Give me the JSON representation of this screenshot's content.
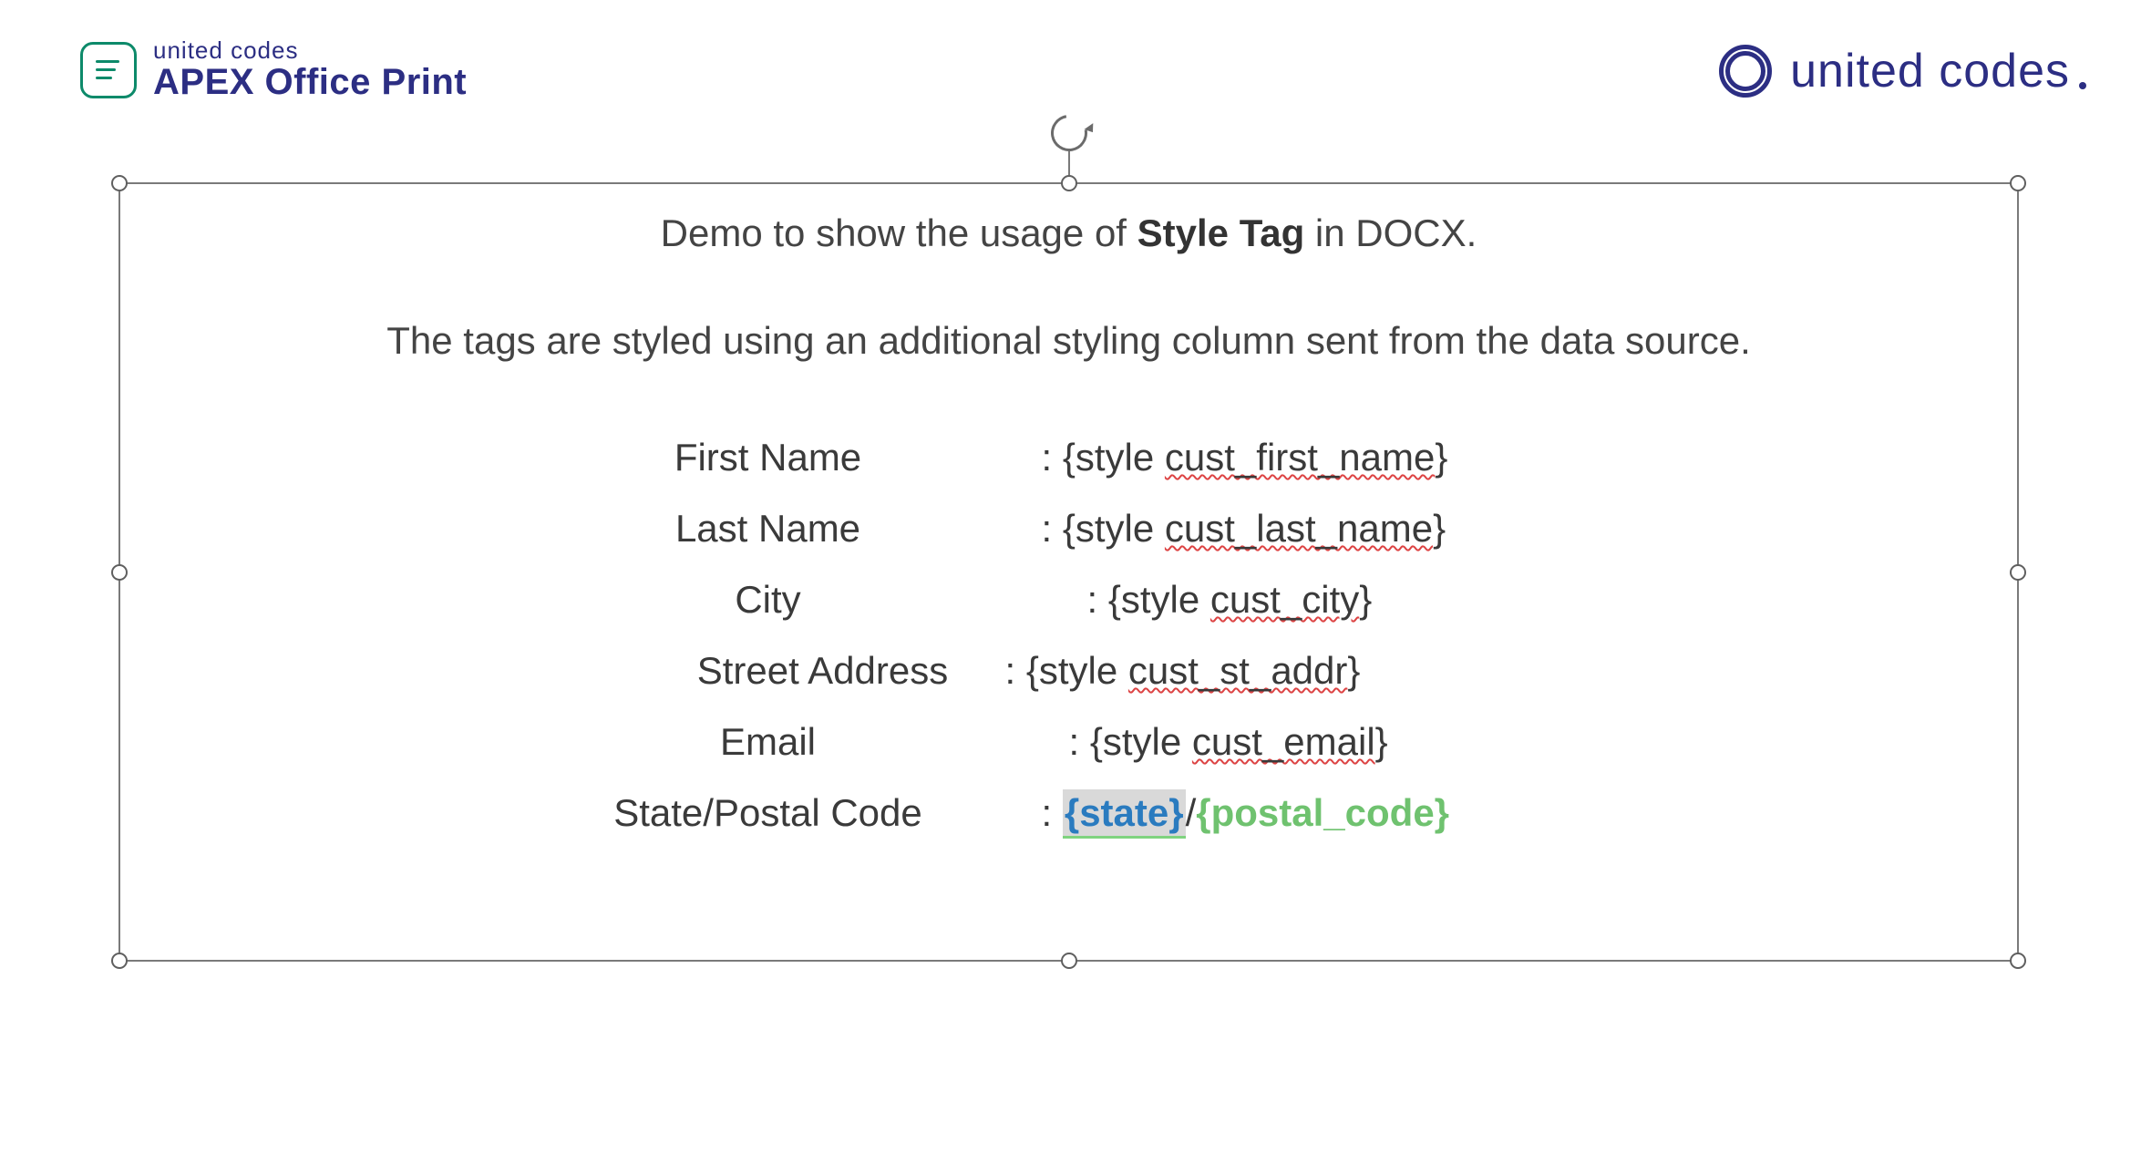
{
  "logos": {
    "left": {
      "small": "united codes",
      "big": "APEX Office Print"
    },
    "right": {
      "text": "united codes"
    }
  },
  "content": {
    "title_prefix": "Demo to show the usage of ",
    "title_bold": "Style Tag",
    "title_suffix": " in DOCX.",
    "subtitle": "The tags are styled using an additional styling column sent from the data source."
  },
  "fields": {
    "first_name": {
      "label": "First Name",
      "prefix": ": {style ",
      "tag": "cust_first_name",
      "suffix": "}"
    },
    "last_name": {
      "label": "Last Name",
      "prefix": ": {style ",
      "tag": "cust_last_name",
      "suffix": "}"
    },
    "city": {
      "label": "City",
      "prefix": ": {style ",
      "tag": "cust_city",
      "suffix": "}"
    },
    "street": {
      "label": "Street Address",
      "prefix": ": {style ",
      "tag": "cust_st_addr",
      "suffix": "}"
    },
    "email": {
      "label": "Email",
      "prefix": ": {style ",
      "tag": "cust_email",
      "suffix": "}"
    },
    "state_postal": {
      "label": "State/Postal Code",
      "colon": ": ",
      "state": "{state}",
      "slash": "/",
      "postal": "{postal_code}"
    }
  }
}
